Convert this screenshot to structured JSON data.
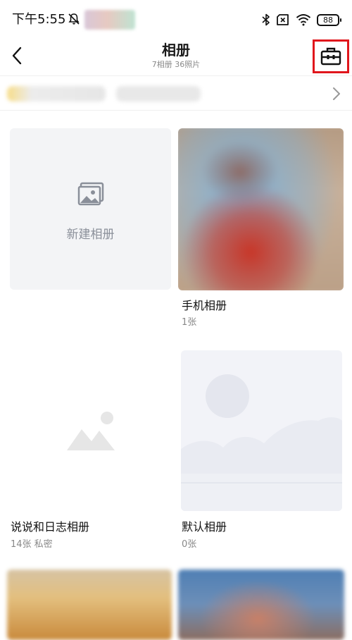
{
  "status_bar": {
    "time": "下午5:55",
    "battery": "88"
  },
  "nav": {
    "title": "相册",
    "subtitle": "7相册  36照片",
    "back_icon": "chevron-left-icon",
    "toolbox_icon": "toolbox-icon",
    "highlight_color": "#e0161c"
  },
  "new_album": {
    "label": "新建相册"
  },
  "albums": [
    {
      "name": "手机相册",
      "meta": "1张"
    },
    {
      "name": "说说和日志相册",
      "meta": "14张  私密"
    },
    {
      "name": "默认相册",
      "meta": "0张"
    }
  ]
}
